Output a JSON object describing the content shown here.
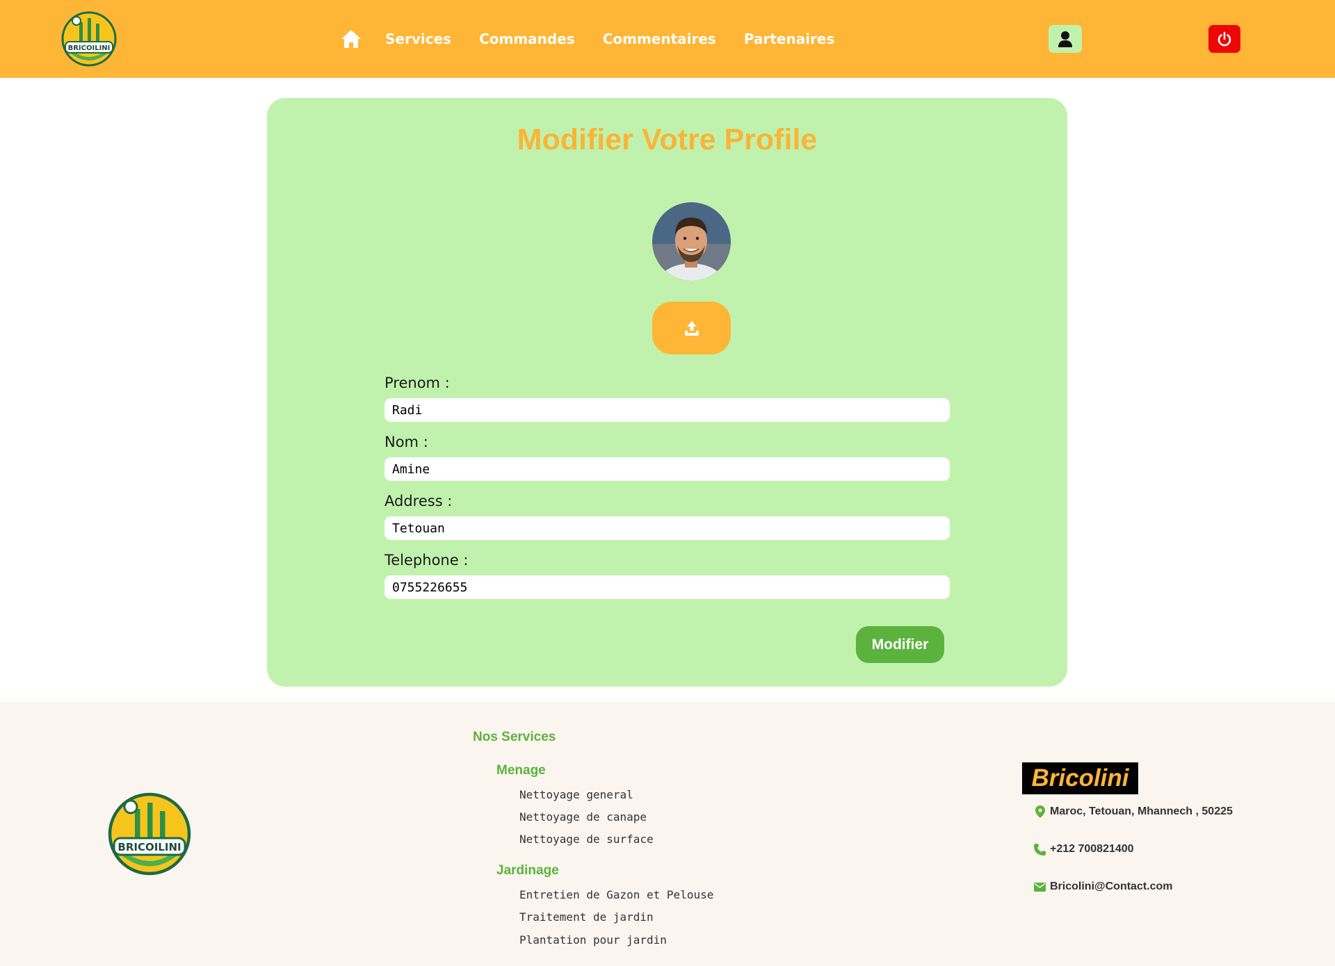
{
  "header": {
    "logo_text": "BRICOILINI",
    "nav": [
      "Services",
      "Commandes",
      "Commentaires",
      "Partenaires"
    ],
    "icons": {
      "home": "home-icon",
      "user": "user-icon",
      "power": "power-icon"
    }
  },
  "form": {
    "title": "Modifier Votre Profile",
    "fields": [
      {
        "label": "Prenom :",
        "value": "Radi"
      },
      {
        "label": "Nom :",
        "value": "Amine"
      },
      {
        "label": "Address :",
        "value": "Tetouan"
      },
      {
        "label": "Telephone :",
        "value": "0755226655"
      }
    ],
    "submit_label": "Modifier",
    "upload_icon": "upload-icon"
  },
  "footer": {
    "logo_text": "BRICOILINI",
    "services_title": "Nos Services",
    "categories": [
      {
        "name": "Menage",
        "items": [
          "Nettoyage general",
          "Nettoyage de canape",
          "Nettoyage de surface"
        ]
      },
      {
        "name": "Jardinage",
        "items": [
          "Entretien de Gazon et Pelouse",
          "Traitement de jardin",
          "Plantation pour jardin"
        ]
      }
    ],
    "brand": "Bricolini",
    "contact": {
      "address": "Maroc, Tetouan, Mhannech , 50225",
      "phone": "+212 700821400",
      "email": "Bricolini@Contact.com"
    }
  },
  "colors": {
    "header": "#ffb535",
    "card": "#c1f2ad",
    "title": "#fbb437",
    "green": "#5bb33d",
    "power": "#ee0707",
    "footer": "#faf5ef"
  }
}
